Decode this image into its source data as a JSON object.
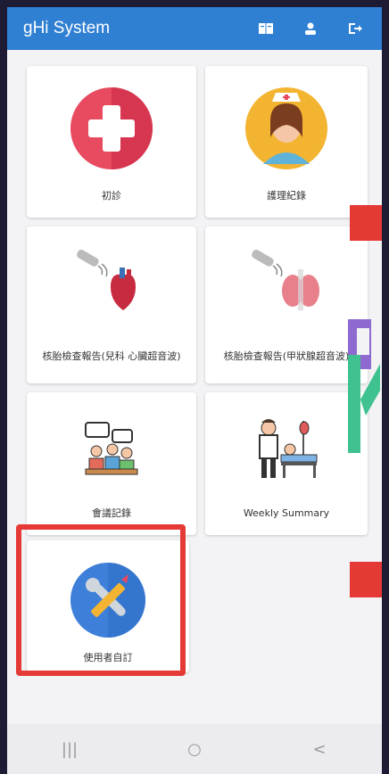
{
  "app": {
    "title": "gHi System"
  },
  "appbar": {
    "icons": [
      "book-icon",
      "user-icon",
      "logout-icon"
    ]
  },
  "cards": [
    {
      "label": "初診",
      "icon": "medical-cross-icon"
    },
    {
      "label": "護理紀錄",
      "icon": "nurse-icon"
    },
    {
      "label": "核胎檢查報告(兒科 心臟超音波)",
      "icon": "heart-ultrasound-icon"
    },
    {
      "label": "核胎檢查報告(甲狀腺超音波)",
      "icon": "thyroid-ultrasound-icon"
    },
    {
      "label": "會議記錄",
      "icon": "meeting-icon"
    },
    {
      "label": "Weekly Summary",
      "icon": "patient-bed-icon"
    },
    {
      "label": "使用者自訂",
      "icon": "tools-icon"
    }
  ],
  "navbar": {
    "recent": "|||",
    "home": "○",
    "back": "<"
  },
  "colors": {
    "appbar": "#2f7fd3",
    "highlight": "#e53935"
  }
}
